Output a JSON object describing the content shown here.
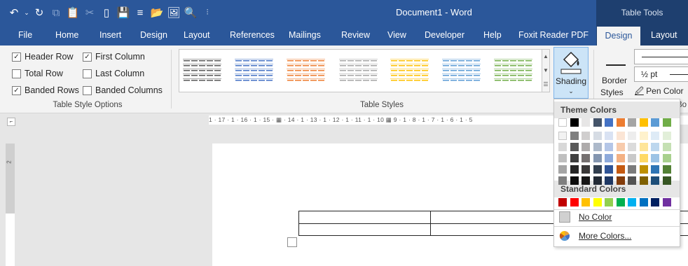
{
  "window": {
    "document_title": "Document1 - Word",
    "contextual_label": "Table Tools"
  },
  "qat": {
    "undo_icon": "undo-icon",
    "redo_icon": "redo-icon"
  },
  "tabs": [
    {
      "label": "File"
    },
    {
      "label": "Home"
    },
    {
      "label": "Insert"
    },
    {
      "label": "Design"
    },
    {
      "label": "Layout"
    },
    {
      "label": "References"
    },
    {
      "label": "Mailings"
    },
    {
      "label": "Review"
    },
    {
      "label": "View"
    },
    {
      "label": "Developer"
    },
    {
      "label": "Help"
    },
    {
      "label": "Foxit Reader PDF"
    },
    {
      "label": "Design",
      "active": true
    },
    {
      "label": "Layout"
    }
  ],
  "table_style_options": {
    "group_label": "Table Style Options",
    "options": [
      {
        "label": "Header Row",
        "checked": true
      },
      {
        "label": "First Column",
        "checked": true
      },
      {
        "label": "Total Row",
        "checked": false
      },
      {
        "label": "Last Column",
        "checked": false
      },
      {
        "label": "Banded Rows",
        "checked": true
      },
      {
        "label": "Banded Columns",
        "checked": false
      }
    ]
  },
  "table_styles": {
    "group_label": "Table Styles",
    "style_accent_colors": [
      "#595959",
      "#4472c4",
      "#ed7d31",
      "#a5a5a5",
      "#ffc000",
      "#5b9bd5",
      "#70ad47"
    ]
  },
  "shading": {
    "label": "Shading",
    "icon": "paint-bucket-icon"
  },
  "borders": {
    "border_styles_label_1": "Border",
    "border_styles_label_2": "Styles",
    "weight_label": "½ pt",
    "pen_color_label": "Pen Color",
    "cut_off_label": "Bo"
  },
  "ruler": {
    "text": "1 · 17 · 1 · 16 · 1 · 15 · ▦ · 14 · 1 · 13 · 1 · 12 · 1 · 11 · 1 · 10 ▦ 9 · 1 · 8 · 1 · 7 · 1 · 6 · 1 · 5"
  },
  "vertical_ruler": {
    "number": "2"
  },
  "dropdown": {
    "theme_header": "Theme Colors",
    "standard_header": "Standard Colors",
    "no_color_label": "No Color",
    "more_colors_label": "More Colors...",
    "theme_top": [
      "#ffffff",
      "#000000",
      "#e7e6e6",
      "#44546a",
      "#4472c4",
      "#ed7d31",
      "#a5a5a5",
      "#ffc000",
      "#5b9bd5",
      "#70ad47"
    ],
    "theme_shades": [
      [
        "#f2f2f2",
        "#7f7f7f",
        "#d0cece",
        "#d6dce4",
        "#d9e2f3",
        "#fbe5d5",
        "#ededed",
        "#fff2cc",
        "#deebf6",
        "#e2efd9"
      ],
      [
        "#d8d8d8",
        "#595959",
        "#aeabab",
        "#adb9ca",
        "#b4c6e7",
        "#f7cbac",
        "#dbdbdb",
        "#fee599",
        "#bdd7ee",
        "#c5e0b3"
      ],
      [
        "#bfbfbf",
        "#3f3f3f",
        "#757070",
        "#8496b0",
        "#8eaadb",
        "#f4b183",
        "#c9c9c9",
        "#ffd965",
        "#9cc3e5",
        "#a8d08d"
      ],
      [
        "#a5a5a5",
        "#262626",
        "#3a3838",
        "#323f4f",
        "#2f5496",
        "#c55a11",
        "#7b7b7b",
        "#bf9000",
        "#2e75b5",
        "#538135"
      ],
      [
        "#7f7f7f",
        "#0c0c0c",
        "#171616",
        "#222a35",
        "#1f3864",
        "#833c0b",
        "#525252",
        "#7f6000",
        "#1e4e79",
        "#375623"
      ]
    ],
    "standard": [
      "#c00000",
      "#ff0000",
      "#ffc000",
      "#ffff00",
      "#92d050",
      "#00b050",
      "#00b0f0",
      "#0070c0",
      "#002060",
      "#7030a0"
    ]
  }
}
